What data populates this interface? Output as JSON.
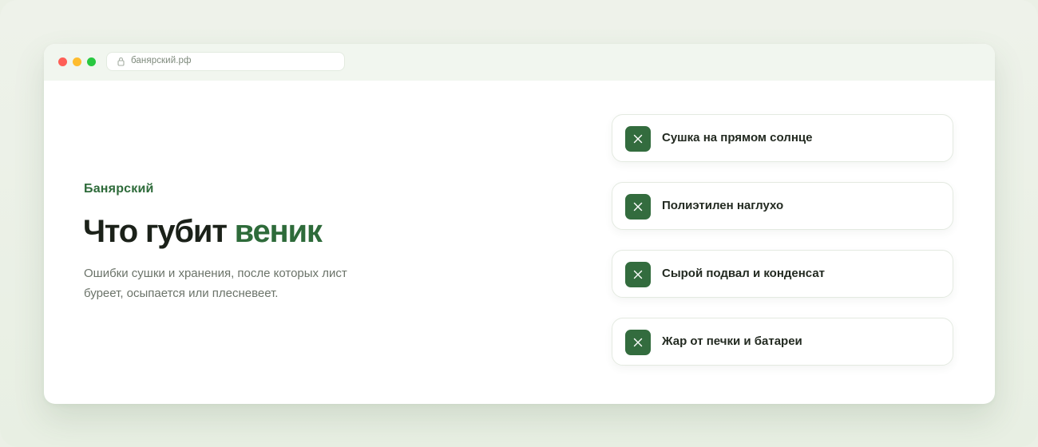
{
  "browser": {
    "url": "банярский.рф",
    "icons": {
      "lock": "lock-icon"
    },
    "window_controls": [
      "close",
      "minimize",
      "maximize"
    ]
  },
  "hero": {
    "brand": "Банярский",
    "headline_prefix": "Что губит",
    "headline_accent": "веник",
    "subtitle": "Ошибки сушки и хранения, после которых лист буреет, осыпается или плесневеет."
  },
  "mistakes": [
    {
      "label": "Сушка на прямом солнце",
      "icon": "cross-icon"
    },
    {
      "label": "Полиэтилен наглухо",
      "icon": "cross-icon"
    },
    {
      "label": "Сырой подвал и конденсат",
      "icon": "cross-icon"
    },
    {
      "label": "Жар от печки и батареи",
      "icon": "cross-icon"
    }
  ],
  "colors": {
    "accent": "#2e6b3a",
    "badge": "#336c3e",
    "background": "#ebf0e6"
  }
}
